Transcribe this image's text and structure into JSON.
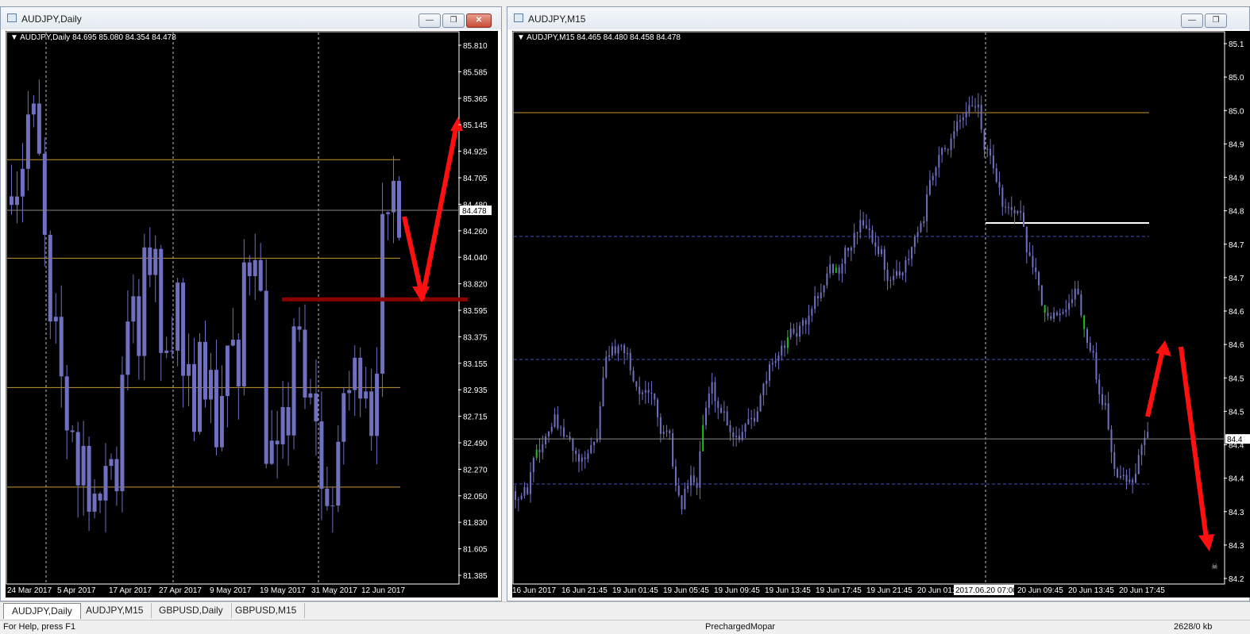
{
  "left_window": {
    "title": "AUDJPY,Daily",
    "info": "AUDJPY,Daily  84.695 85.080 84.354 84.478",
    "current_price": "84.478",
    "price_labels": [
      "85.810",
      "85.585",
      "85.365",
      "85.145",
      "84.925",
      "84.705",
      "84.480",
      "84.260",
      "84.040",
      "83.820",
      "83.595",
      "83.375",
      "83.155",
      "82.935",
      "82.715",
      "82.490",
      "82.270",
      "82.050",
      "81.830",
      "81.605",
      "81.385"
    ],
    "date_labels": [
      "24 Mar 2017",
      "5 Apr 2017",
      "17 Apr 2017",
      "27 Apr 2017",
      "9 May 2017",
      "19 May 2017",
      "31 May 2017",
      "12 Jun 2017"
    ],
    "level_lines": [
      84.92,
      84.06,
      82.93,
      82.06
    ],
    "candle_color": "#7070c0",
    "level_color": "#c8962c",
    "support_color": "#8b0000"
  },
  "right_window": {
    "title": "AUDJPY,M15",
    "info": "AUDJPY,M15  84.465 84.480 84.458 84.478",
    "current_price": "84.4",
    "price_labels": [
      "85.1",
      "85.0",
      "85.0",
      "84.9",
      "84.9",
      "84.8",
      "84.7",
      "84.7",
      "84.6",
      "84.6",
      "84.5",
      "84.5",
      "84.4",
      "84.4",
      "84.3",
      "84.3",
      "84.2"
    ],
    "date_labels": [
      "16 Jun 2017",
      "16 Jun 21:45",
      "19 Jun 01:45",
      "19 Jun 05:45",
      "19 Jun 09:45",
      "19 Jun 13:45",
      "19 Jun 17:45",
      "19 Jun 21:45",
      "20 Jun 01:",
      "2017.06.20 07:00",
      "20 Jun 09:45",
      "20 Jun 13:45",
      "20 Jun 17:45"
    ],
    "dashed_color": "#4050c0"
  },
  "tabs": [
    "AUDJPY,Daily",
    "AUDJPY,M15",
    "GBPUSD,Daily",
    "GBPUSD,M15"
  ],
  "status": {
    "help": "For Help, press F1",
    "profile": "PrechargedMopar",
    "traffic": "2628/0 kb"
  },
  "icons": {
    "minimize": "minimize-icon",
    "restore": "restore-icon",
    "close": "close-icon",
    "window": "chart-window-icon"
  }
}
